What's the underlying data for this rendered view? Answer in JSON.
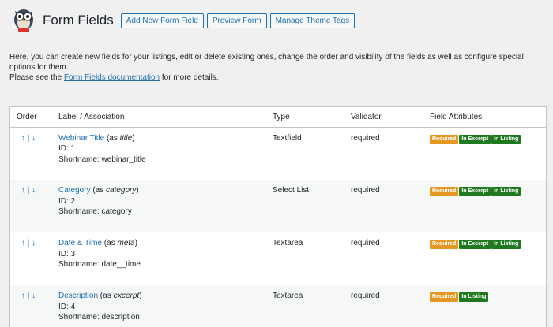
{
  "header": {
    "title": "Form Fields",
    "buttons": [
      "Add New Form Field",
      "Preview Form",
      "Manage Theme Tags"
    ]
  },
  "intro": {
    "line1": "Here, you can create new fields for your listings, edit or delete existing ones, change the order and visibility of the fields as well as configure special options for them.",
    "line2_prefix": "Please see the ",
    "line2_link": "Form Fields documentation",
    "line2_suffix": " for more details."
  },
  "table": {
    "columns": [
      "Order",
      "Label / Association",
      "Type",
      "Validator",
      "Field Attributes"
    ],
    "rows": [
      {
        "up": "↑",
        "sep": "|",
        "down": "↓",
        "label": "Webinar Title",
        "as_prefix": " (as ",
        "as_value": "title",
        "as_suffix": ")",
        "id": "ID: 1",
        "shortname": "Shortname: webinar_title",
        "type": "Textfield",
        "validator": "required",
        "badges": [
          "Required",
          "In Excerpt",
          "In Listing"
        ]
      },
      {
        "up": "↑",
        "sep": "|",
        "down": "↓",
        "label": "Category",
        "as_prefix": " (as ",
        "as_value": "category",
        "as_suffix": ")",
        "id": "ID: 2",
        "shortname": "Shortname: category",
        "type": "Select List",
        "validator": "required",
        "badges": [
          "Required",
          "In Excerpt",
          "In Listing"
        ]
      },
      {
        "up": "↑",
        "sep": "|",
        "down": "↓",
        "label": "Date & Time",
        "as_prefix": " (as ",
        "as_value": "meta",
        "as_suffix": ")",
        "id": "ID: 3",
        "shortname": "Shortname: date__time",
        "type": "Textarea",
        "validator": "required",
        "badges": [
          "Required",
          "In Excerpt",
          "In Listing"
        ]
      },
      {
        "up": "↑",
        "sep": "|",
        "down": "↓",
        "label": "Description",
        "as_prefix": " (as ",
        "as_value": "excerpt",
        "as_suffix": ")",
        "id": "ID: 4",
        "shortname": "Shortname: description",
        "type": "Textarea",
        "validator": "required",
        "badges": [
          "Required",
          "In Listing"
        ]
      }
    ]
  },
  "colors": {
    "link": "#2271b1",
    "required_badge": "#e59723",
    "green_badge": "#1f7a1f",
    "background": "#f0f0f1"
  }
}
